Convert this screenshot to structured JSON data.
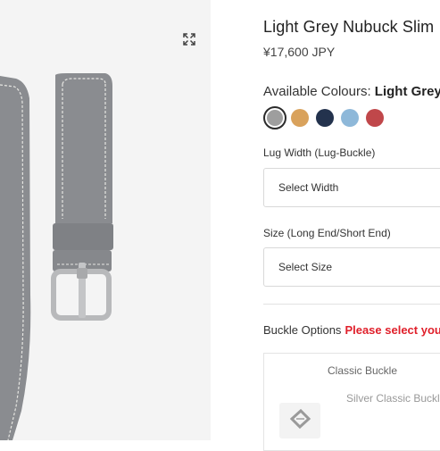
{
  "product": {
    "title": "Light Grey Nubuck Slim",
    "price": "¥17,600 JPY"
  },
  "icons": {
    "expand": "expand-arrows-icon",
    "buckle": "buckle-icon"
  },
  "colours": {
    "label": "Available Colours:",
    "selected_name": "Light Grey",
    "swatches": [
      {
        "name": "light-grey",
        "color": "#9e9e9e",
        "selected": true
      },
      {
        "name": "tan",
        "color": "#d9a25c",
        "selected": false
      },
      {
        "name": "navy",
        "color": "#23324d",
        "selected": false
      },
      {
        "name": "light-blue",
        "color": "#8eb8d9",
        "selected": false
      },
      {
        "name": "red",
        "color": "#c0474a",
        "selected": false
      }
    ]
  },
  "lug_width": {
    "label": "Lug Width (Lug-Buckle)",
    "value": "Select Width"
  },
  "size": {
    "label": "Size (Long End/Short End)",
    "value": "Select Size"
  },
  "buckle": {
    "label": "Buckle Options",
    "warning": "Please select you",
    "panel_title": "Classic Buckle",
    "option_label": "Silver Classic Buckle"
  },
  "theme": {
    "strap_color": "#8a8c90",
    "stitch_color": "#e6e6e2",
    "warning_color": "#e0202b"
  }
}
